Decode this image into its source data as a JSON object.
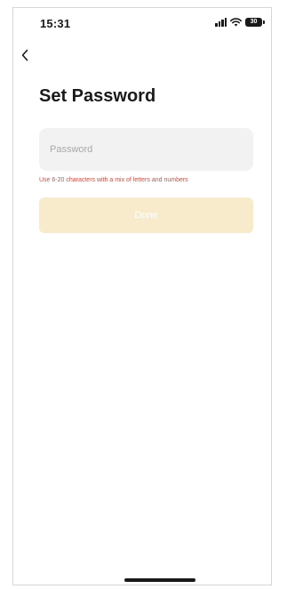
{
  "status_bar": {
    "time": "15:31",
    "battery_level": "30",
    "icons": [
      "signal-icon",
      "wifi-icon",
      "battery-icon"
    ]
  },
  "nav": {
    "back_icon": "chevron-left-icon"
  },
  "page": {
    "title": "Set Password"
  },
  "form": {
    "password_value": "",
    "password_placeholder": "Password",
    "hint": "Use 6-20 characters with a mix of letters and numbers",
    "done_label": "Done"
  },
  "colors": {
    "hint_red": "#d64b3f",
    "done_disabled_bg": "#f8ebcb",
    "field_bg": "#f2f2f2"
  }
}
